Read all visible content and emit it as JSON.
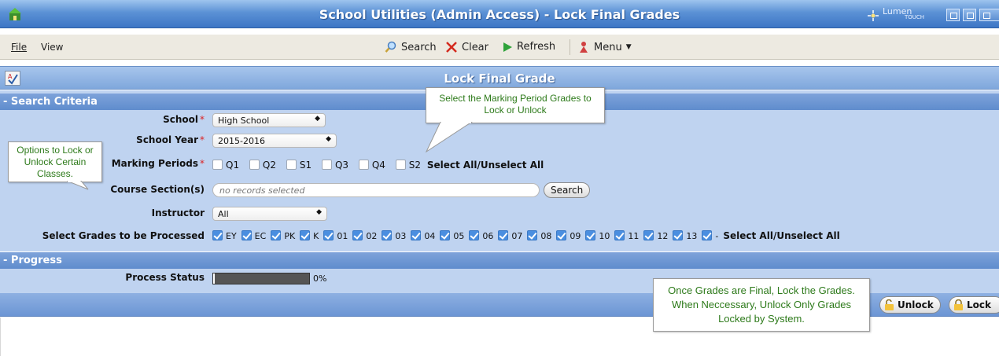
{
  "window": {
    "title": "School Utilities (Admin Access) - Lock Final Grades",
    "brand": "Lumen",
    "brand_sub": "TOUCH"
  },
  "menubar": {
    "file": "File",
    "view": "View"
  },
  "toolbar": {
    "search": "Search",
    "clear": "Clear",
    "refresh": "Refresh",
    "menu": "Menu"
  },
  "page": {
    "title": "Lock Final Grade"
  },
  "search_criteria": {
    "header": "- Search Criteria",
    "school_label": "School",
    "school_value": "High School",
    "school_year_label": "School Year",
    "school_year_value": "2015-2016",
    "marking_periods_label": "Marking Periods",
    "marking_periods": [
      {
        "label": "Q1",
        "checked": false
      },
      {
        "label": "Q2",
        "checked": false
      },
      {
        "label": "S1",
        "checked": false
      },
      {
        "label": "Q3",
        "checked": false
      },
      {
        "label": "Q4",
        "checked": false
      },
      {
        "label": "S2",
        "checked": false
      }
    ],
    "select_all": "Select All",
    "unselect_all": "Unselect All",
    "slash": "/",
    "course_section_label": "Course Section(s)",
    "course_section_placeholder": "no records selected",
    "search_button": "Search",
    "instructor_label": "Instructor",
    "instructor_value": "All",
    "grades_label": "Select Grades to be Processed",
    "grades": [
      {
        "label": "EY",
        "checked": true
      },
      {
        "label": "EC",
        "checked": true
      },
      {
        "label": "PK",
        "checked": true
      },
      {
        "label": "K",
        "checked": true
      },
      {
        "label": "01",
        "checked": true
      },
      {
        "label": "02",
        "checked": true
      },
      {
        "label": "03",
        "checked": true
      },
      {
        "label": "04",
        "checked": true
      },
      {
        "label": "05",
        "checked": true
      },
      {
        "label": "06",
        "checked": true
      },
      {
        "label": "07",
        "checked": true
      },
      {
        "label": "08",
        "checked": true
      },
      {
        "label": "09",
        "checked": true
      },
      {
        "label": "10",
        "checked": true
      },
      {
        "label": "11",
        "checked": true
      },
      {
        "label": "12",
        "checked": true
      },
      {
        "label": "13",
        "checked": true
      },
      {
        "label": "-",
        "checked": true
      }
    ]
  },
  "progress": {
    "header": "- Progress",
    "status_label": "Process Status",
    "percent_text": "0%",
    "percent_value": 0
  },
  "actions": {
    "unlock": "Unlock",
    "lock": "Lock"
  },
  "callouts": {
    "marking_period_note": "Select the Marking Period Grades to Lock or Unlock",
    "options_note": "Options to Lock or Unlock Certain Classes.",
    "final_note": "Once Grades are Final, Lock the Grades.  When Neccessary, Unlock Only Grades Locked by System."
  },
  "colors": {
    "title_bar": "#5b91d5",
    "form_bg": "#bfd3f0",
    "callout_text": "#2d7a1a",
    "checkbox_checked": "#4a8ee0",
    "required": "#dd2222"
  }
}
